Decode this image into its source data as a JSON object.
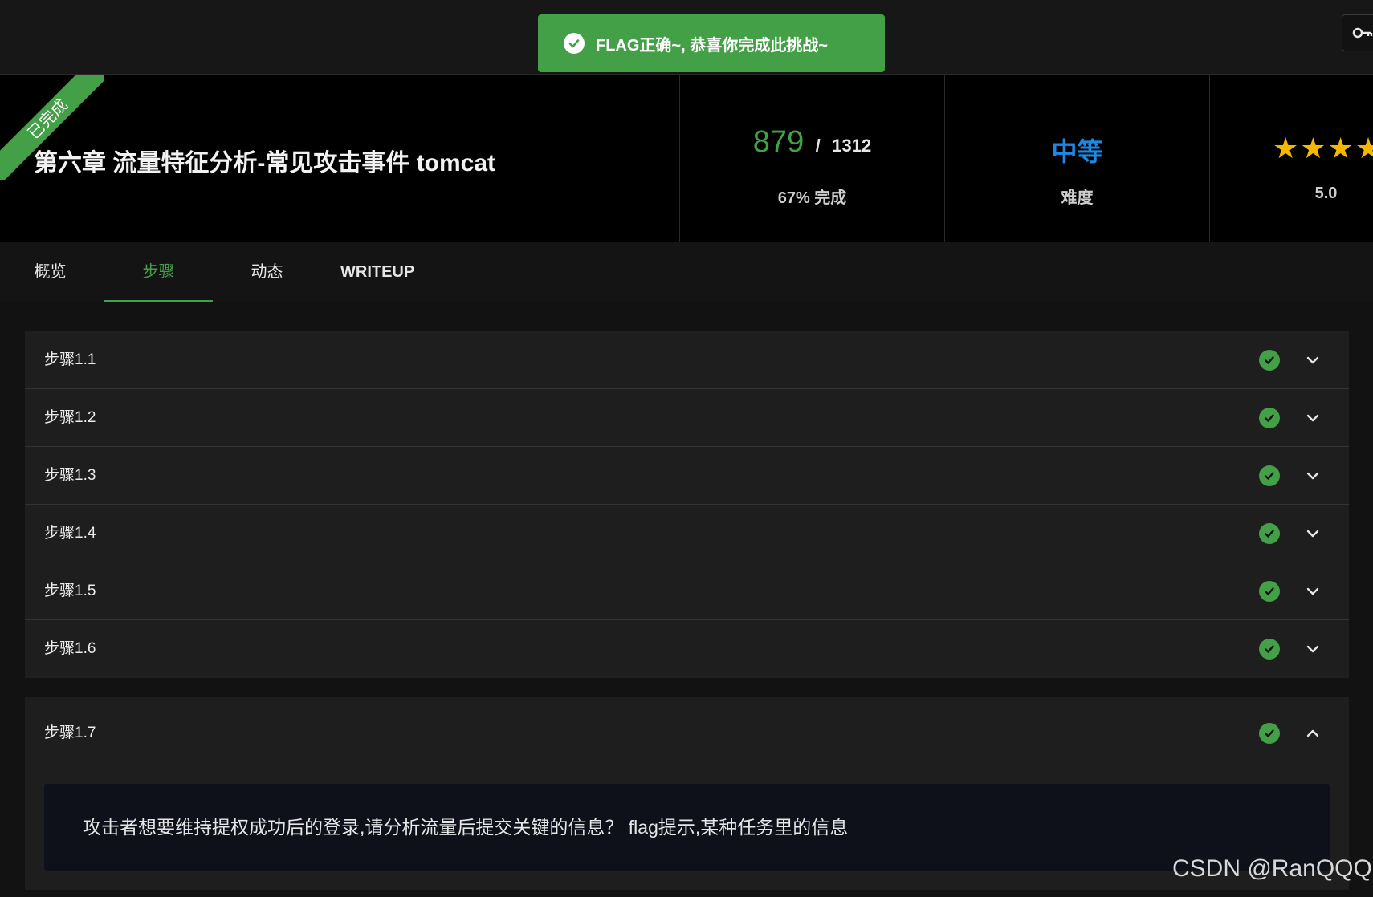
{
  "toast": {
    "message": "FLAG正确~, 恭喜你完成此挑战~",
    "icon": "check-circle-icon"
  },
  "topbar": {
    "key_icon": "key-icon"
  },
  "header": {
    "ribbon": "已完成",
    "title": "第六章 流量特征分析-常见攻击事件 tomcat",
    "score": "879",
    "score_sep": "/",
    "score_total": "1312",
    "completion": "67% 完成",
    "difficulty": "中等",
    "difficulty_label": "难度",
    "stars": "★★★★★",
    "rating": "5.0"
  },
  "tabs": [
    {
      "label": "概览",
      "active": false
    },
    {
      "label": "步骤",
      "active": true
    },
    {
      "label": "动态",
      "active": false
    },
    {
      "label": "WRITEUP",
      "active": false
    }
  ],
  "steps": [
    {
      "label": "步骤1.1",
      "status": "completed"
    },
    {
      "label": "步骤1.2",
      "status": "completed"
    },
    {
      "label": "步骤1.3",
      "status": "completed"
    },
    {
      "label": "步骤1.4",
      "status": "completed"
    },
    {
      "label": "步骤1.5",
      "status": "completed"
    },
    {
      "label": "步骤1.6",
      "status": "completed"
    }
  ],
  "open_step": {
    "label": "步骤1.7",
    "status": "completed",
    "description": "攻击者想要维持提权成功后的登录,请分析流量后提交关键的信息？ flag提示,某种任务里的信息"
  },
  "watermark": "CSDN @RanQQQ",
  "colors": {
    "accent": "#43a047",
    "difficulty": "#1e88e5",
    "stars": "#f5b800",
    "background": "#121212"
  }
}
